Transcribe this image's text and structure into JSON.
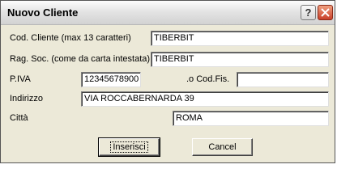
{
  "window": {
    "title": "Nuovo Cliente",
    "help_label": "?",
    "close_icon": "close-icon"
  },
  "form": {
    "cod_cliente": {
      "label": "Cod. Cliente (max 13 caratteri)",
      "value": "TIBERBIT"
    },
    "rag_soc": {
      "label": "Rag. Soc. (come da carta intestata)",
      "value": "TIBERBIT"
    },
    "piva": {
      "label": "P.IVA",
      "value": "12345678900"
    },
    "cod_fis": {
      "label": ".o Cod.Fis.",
      "value": ""
    },
    "indirizzo": {
      "label": "Indirizzo",
      "value": "VIA ROCCABERNARDA 39"
    },
    "citta": {
      "label": "Città",
      "value": "ROMA"
    }
  },
  "buttons": {
    "insert_label": "Inserisci",
    "cancel_label": "Cancel"
  }
}
